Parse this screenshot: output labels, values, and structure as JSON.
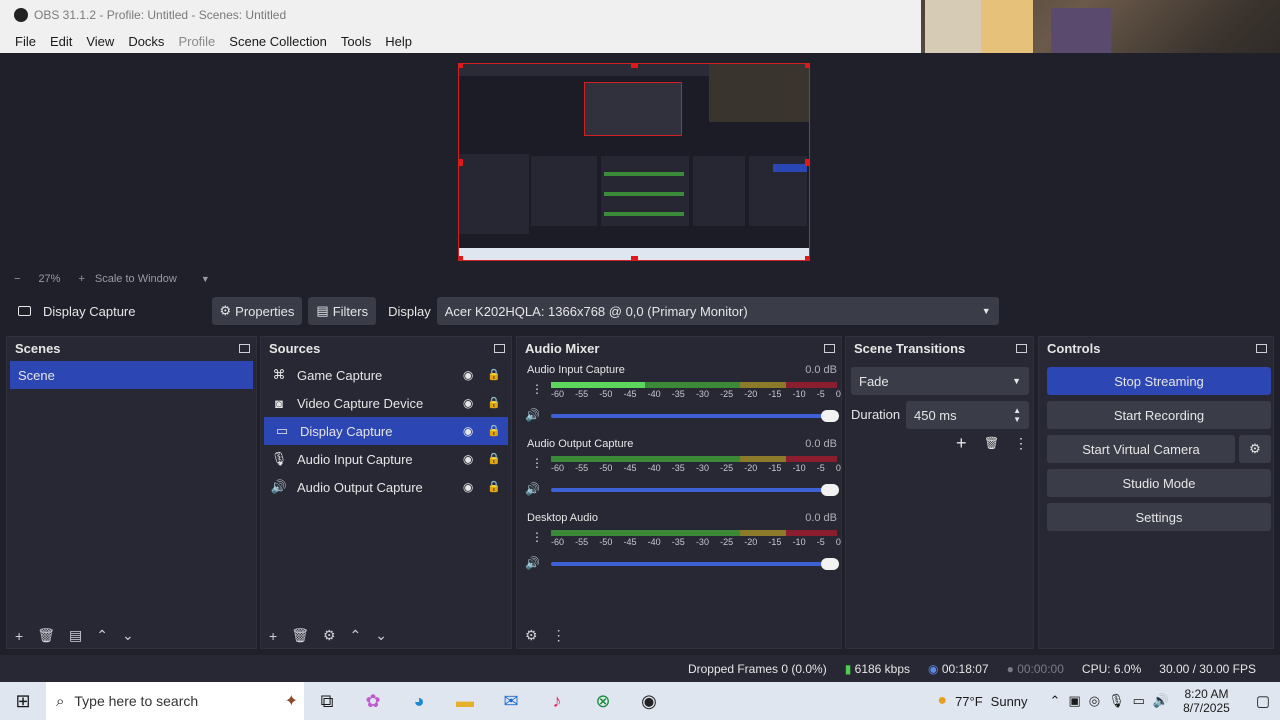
{
  "window": {
    "title": "OBS 31.1.2 - Profile: Untitled - Scenes: Untitled"
  },
  "menu": [
    "File",
    "Edit",
    "View",
    "Docks",
    "Profile",
    "Scene Collection",
    "Tools",
    "Help"
  ],
  "zoom": {
    "minus": "−",
    "level": "27%",
    "plus": "+",
    "mode": "Scale to Window"
  },
  "source_bar": {
    "source_name": "Display Capture",
    "properties": "Properties",
    "filters": "Filters",
    "display_label": "Display",
    "display_value": "Acer K202HQLA: 1366x768 @ 0,0 (Primary Monitor)"
  },
  "scenes": {
    "title": "Scenes",
    "items": [
      "Scene"
    ]
  },
  "sources": {
    "title": "Sources",
    "items": [
      {
        "label": "Game Capture",
        "icon": "gamepad-icon"
      },
      {
        "label": "Video Capture Device",
        "icon": "camera-icon"
      },
      {
        "label": "Display Capture",
        "icon": "monitor-icon"
      },
      {
        "label": "Audio Input Capture",
        "icon": "microphone-icon"
      },
      {
        "label": "Audio Output Capture",
        "icon": "speaker-icon"
      }
    ]
  },
  "mixer": {
    "title": "Audio Mixer",
    "ticks": [
      "-60",
      "-55",
      "-50",
      "-45",
      "-40",
      "-35",
      "-30",
      "-25",
      "-20",
      "-15",
      "-10",
      "-5",
      "0"
    ],
    "channels": [
      {
        "name": "Audio Input Capture",
        "db": "0.0 dB",
        "level": 0.33
      },
      {
        "name": "Audio Output Capture",
        "db": "0.0 dB",
        "level": 0
      },
      {
        "name": "Desktop Audio",
        "db": "0.0 dB",
        "level": 0
      }
    ]
  },
  "transitions": {
    "title": "Scene Transitions",
    "type": "Fade",
    "duration_label": "Duration",
    "duration_value": "450 ms"
  },
  "controls": {
    "title": "Controls",
    "stop_streaming": "Stop Streaming",
    "start_recording": "Start Recording",
    "start_virtual_camera": "Start Virtual Camera",
    "studio_mode": "Studio Mode",
    "settings": "Settings"
  },
  "status": {
    "dropped_frames": "Dropped Frames 0 (0.0%)",
    "bitrate": "6186 kbps",
    "stream_time": "00:18:07",
    "rec_time": "00:00:00",
    "cpu": "CPU: 6.0%",
    "fps": "30.00 / 30.00 FPS"
  },
  "taskbar": {
    "search_placeholder": "Type here to search",
    "weather_temp": "77°F",
    "weather_desc": "Sunny",
    "time": "8:20 AM",
    "date": "8/7/2025"
  },
  "colors": {
    "accent": "#2c46b4",
    "panel": "#272833",
    "background": "#1f2029",
    "selection_border": "#e01818"
  }
}
